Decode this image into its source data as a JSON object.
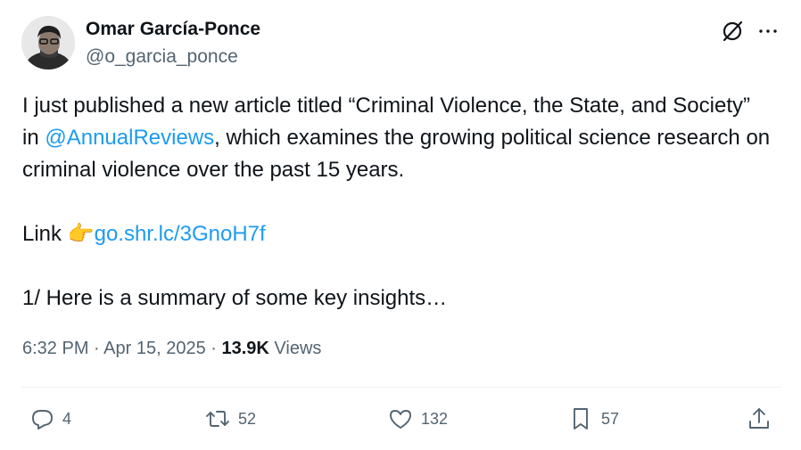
{
  "author": {
    "display_name": "Omar García-Ponce",
    "handle": "@o_garcia_ponce"
  },
  "header_icons": {
    "grok": "grok-icon",
    "more": "more-icon"
  },
  "tweet": {
    "line1_a": "I just published a new article titled “Criminal Violence, the State, and Society” in ",
    "mention": "@AnnualReviews",
    "line1_b": ", which examines the growing political science research on criminal violence over the past 15 years.",
    "link_prefix": "Link ",
    "link_emoji": "👉",
    "link_url": "go.shr.lc/3GnoH7f",
    "thread_line": "1/ Here is a summary of some key insights…"
  },
  "meta": {
    "time": "6:32 PM",
    "sep1": " · ",
    "date": "Apr 15, 2025",
    "sep2": " · ",
    "views_count": "13.9K",
    "views_label": " Views"
  },
  "actions": {
    "replies": "4",
    "reposts": "52",
    "likes": "132",
    "bookmarks": "57"
  },
  "colors": {
    "link": "#1d9bf0",
    "text": "#0f1419",
    "secondary": "#536471"
  }
}
